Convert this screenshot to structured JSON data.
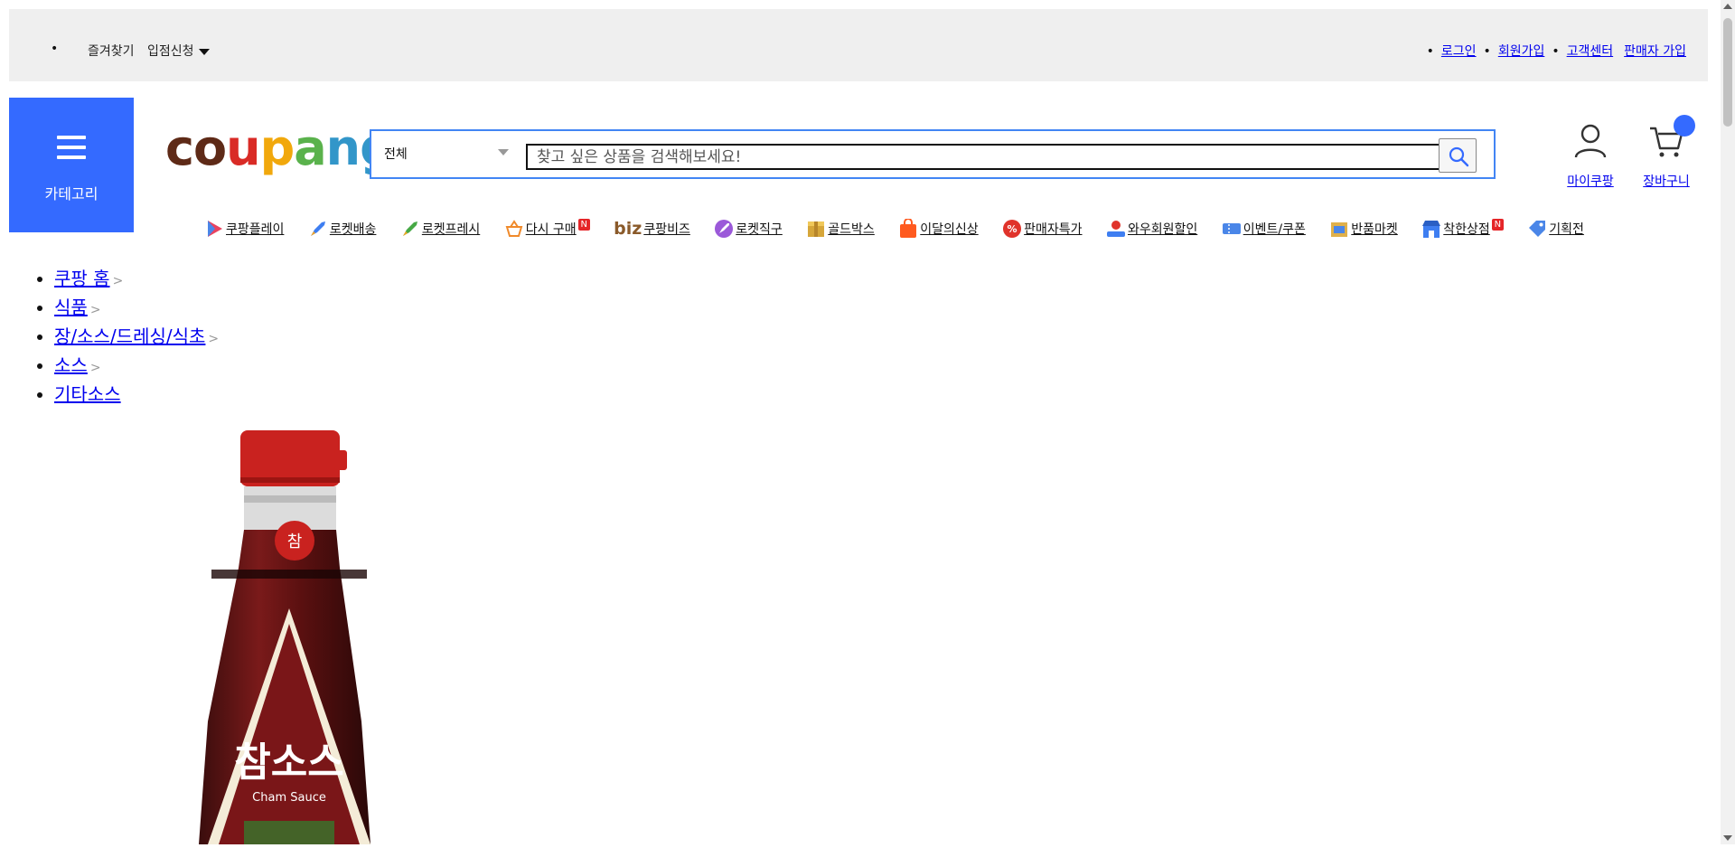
{
  "topbar": {
    "left": {
      "favorites": "즐겨찾기",
      "apply": "입점신청"
    },
    "right": [
      "로그인",
      "회원가입",
      "고객센터",
      "판매자 가입"
    ]
  },
  "category": {
    "label": "카테고리"
  },
  "logo": {
    "text": "coupang"
  },
  "search": {
    "category_selected": "전체",
    "placeholder": "찾고 싶은 상품을 검색해보세요!"
  },
  "account": {
    "mypage": "마이쿠팡",
    "cart": "장바구니"
  },
  "nav": [
    {
      "label": "쿠팡플레이",
      "icon": "play-icon",
      "color": "#e9435f"
    },
    {
      "label": "로켓배송",
      "icon": "rocket-icon",
      "color": "#3e7ef1"
    },
    {
      "label": "로켓프레시",
      "icon": "rocket-fresh-icon",
      "color": "#46a945"
    },
    {
      "label": "다시 구매",
      "icon": "basket-icon",
      "color": "#f08a2b",
      "badge": "N"
    },
    {
      "label": "쿠팡비즈",
      "icon": "biz-logo",
      "prefix": "biz"
    },
    {
      "label": "로켓직구",
      "icon": "rocket-global-icon",
      "color": "#9b59d9"
    },
    {
      "label": "골드박스",
      "icon": "gold-box-icon",
      "color": "#d6a63a"
    },
    {
      "label": "이달의신상",
      "icon": "new-bag-icon",
      "color": "#ff5a1f"
    },
    {
      "label": "판매자특가",
      "icon": "percent-badge-icon",
      "color": "#e0332b"
    },
    {
      "label": "와우회원할인",
      "icon": "wow-icon",
      "color": "#e0332b"
    },
    {
      "label": "이벤트/쿠폰",
      "icon": "coupon-icon",
      "color": "#4a86e8"
    },
    {
      "label": "반품마켓",
      "icon": "return-market-icon",
      "color": "#e0b04a"
    },
    {
      "label": "착한상점",
      "icon": "store-icon",
      "color": "#3e7ef1",
      "badge": "N"
    },
    {
      "label": "기획전",
      "icon": "tag-icon",
      "color": "#4a86e8"
    }
  ],
  "breadcrumb": [
    "쿠팡 홈",
    "식품",
    "장/소스/드레싱/식초",
    "소스",
    "기타소스"
  ],
  "product": {
    "brand_logo_text": "참",
    "label_title": "참소스",
    "label_sub": "Cham Sauce"
  }
}
